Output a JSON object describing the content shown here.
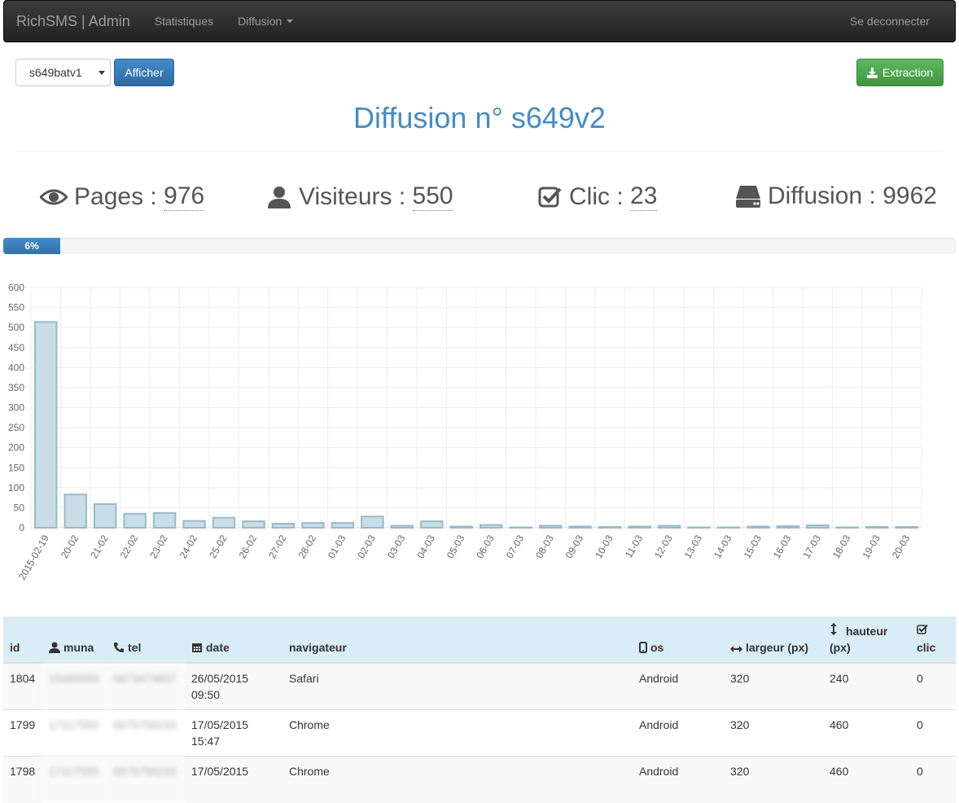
{
  "navbar": {
    "brand": "RichSMS | Admin",
    "items": [
      {
        "label": "Statistiques"
      },
      {
        "label": "Diffusion"
      }
    ],
    "logout": "Se deconnecter"
  },
  "toolbar": {
    "select_value": "s649batv1",
    "show_button": "Afficher",
    "export_button": "Extraction"
  },
  "title": "Diffusion n° s649v2",
  "stats": {
    "pages": {
      "label": "Pages :",
      "value": "976"
    },
    "visitors": {
      "label": "Visiteurs :",
      "value": "550"
    },
    "clicks": {
      "label": "Clic :",
      "value": "23"
    },
    "diffusion": {
      "label": "Diffusion :",
      "value": "9962"
    }
  },
  "progress": {
    "value": 6,
    "label": "6%"
  },
  "chart_data": {
    "type": "bar",
    "categories": [
      "2015-02-19",
      "20-02",
      "21-02",
      "22-02",
      "23-02",
      "24-02",
      "25-02",
      "26-02",
      "27-02",
      "28-02",
      "01-03",
      "02-03",
      "03-03",
      "04-03",
      "05-03",
      "06-03",
      "07-03",
      "08-03",
      "09-03",
      "10-03",
      "11-03",
      "12-03",
      "13-03",
      "14-03",
      "15-03",
      "16-03",
      "17-03",
      "18-03",
      "19-03",
      "20-03"
    ],
    "values": [
      514,
      83,
      59,
      35,
      37,
      17,
      25,
      16,
      10,
      12,
      12,
      28,
      5,
      16,
      3,
      7,
      1,
      5,
      3,
      2,
      3,
      5,
      1,
      1,
      3,
      4,
      6,
      1,
      2,
      2
    ],
    "ylim": [
      0,
      600
    ],
    "yticks": [
      0,
      50,
      100,
      150,
      200,
      250,
      300,
      350,
      400,
      450,
      500,
      550,
      600
    ],
    "grid": true,
    "color": "#c9dde6",
    "border_color": "#97bbcd"
  },
  "table": {
    "columns": [
      "id",
      "muna",
      "tel",
      "date",
      "navigateur",
      "os",
      "largeur (px)",
      "hauteur (px)",
      "clic"
    ],
    "rows": [
      {
        "id": "1804",
        "muna": "15489955",
        "tel": "0673474837",
        "date": "26/05/2015 09:50",
        "navigateur": "Safari",
        "os": "Android",
        "largeur": "320",
        "hauteur": "240",
        "clic": "0"
      },
      {
        "id": "1799",
        "muna": "17117555",
        "tel": "0675756233",
        "date": "17/05/2015 15:47",
        "navigateur": "Chrome",
        "os": "Android",
        "largeur": "320",
        "hauteur": "460",
        "clic": "0"
      },
      {
        "id": "1798",
        "muna": "17117555",
        "tel": "0675756233",
        "date": "17/05/2015",
        "navigateur": "Chrome",
        "os": "Android",
        "largeur": "320",
        "hauteur": "460",
        "clic": "0"
      }
    ]
  }
}
